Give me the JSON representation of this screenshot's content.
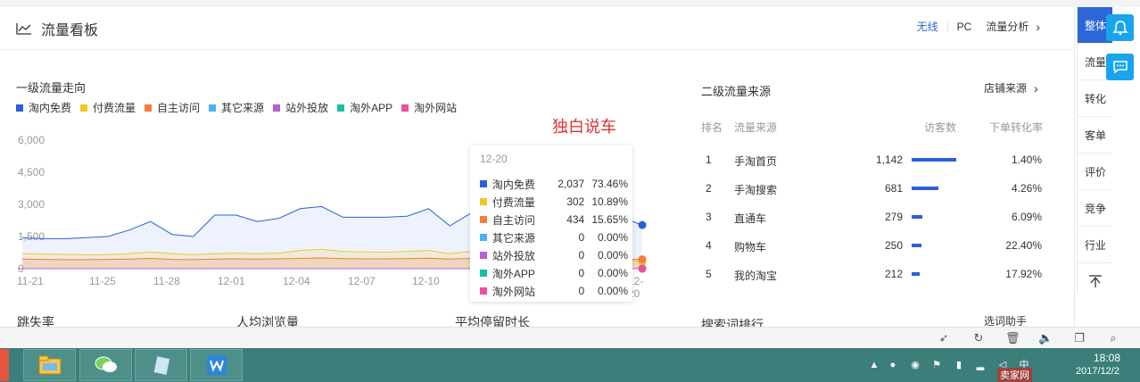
{
  "header": {
    "title": "流量看板",
    "tabs": [
      "无线",
      "PC"
    ],
    "analysis_link": "流量分析"
  },
  "primary": {
    "title": "一级流量走向",
    "legend": [
      {
        "name": "淘内免费",
        "color": "#2b5fd9"
      },
      {
        "name": "付费流量",
        "color": "#f2c526"
      },
      {
        "name": "自主访问",
        "color": "#f57c3a"
      },
      {
        "name": "其它来源",
        "color": "#49b1f5"
      },
      {
        "name": "站外投放",
        "color": "#b45fd6"
      },
      {
        "name": "淘外APP",
        "color": "#13c2a3"
      },
      {
        "name": "淘外网站",
        "color": "#ee4e9a"
      }
    ],
    "watermark": "独白说车"
  },
  "chart_data": {
    "type": "area",
    "x": [
      "11-21",
      "11-22",
      "11-23",
      "11-24",
      "11-25",
      "11-26",
      "11-27",
      "11-28",
      "11-29",
      "11-30",
      "12-01",
      "12-02",
      "12-03",
      "12-04",
      "12-05",
      "12-06",
      "12-07",
      "12-08",
      "12-09",
      "12-10",
      "12-11",
      "12-12",
      "12-13",
      "12-14",
      "12-15",
      "12-16",
      "12-17",
      "12-18",
      "12-19",
      "12-20"
    ],
    "x_tick_labels": [
      "11-21",
      "11-25",
      "11-28",
      "12-01",
      "12-04",
      "12-07",
      "12-10",
      "12-20"
    ],
    "y_tick_labels": [
      "6,000",
      "4,500",
      "3,000",
      "1,500",
      "0"
    ],
    "ylim": [
      0,
      6000
    ],
    "series": [
      {
        "name": "淘内免费",
        "color": "#2b5fd9",
        "values": [
          1450,
          1400,
          1400,
          1450,
          1500,
          1800,
          2200,
          1600,
          1500,
          2500,
          2500,
          2200,
          2350,
          2800,
          2900,
          2400,
          2400,
          2400,
          2450,
          2800,
          2000,
          2600,
          2800,
          3200,
          4300,
          3900,
          3400,
          2600,
          2400,
          2037
        ]
      },
      {
        "name": "付费流量",
        "color": "#f2c526",
        "values": [
          700,
          680,
          660,
          650,
          650,
          700,
          780,
          700,
          650,
          700,
          720,
          700,
          720,
          850,
          900,
          800,
          780,
          770,
          800,
          850,
          700,
          800,
          900,
          1000,
          1600,
          1400,
          1200,
          800,
          500,
          302
        ]
      },
      {
        "name": "自主访问",
        "color": "#f57c3a",
        "values": [
          450,
          430,
          420,
          420,
          430,
          450,
          480,
          430,
          420,
          450,
          460,
          450,
          460,
          480,
          500,
          470,
          460,
          460,
          470,
          490,
          450,
          480,
          500,
          520,
          650,
          600,
          550,
          480,
          450,
          434
        ]
      },
      {
        "name": "其它来源",
        "color": "#49b1f5",
        "values": [
          0,
          0,
          0,
          0,
          0,
          0,
          0,
          0,
          0,
          0,
          0,
          0,
          0,
          0,
          0,
          0,
          0,
          0,
          0,
          0,
          0,
          0,
          0,
          0,
          0,
          0,
          0,
          0,
          0,
          0
        ]
      },
      {
        "name": "站外投放",
        "color": "#b45fd6",
        "values": [
          0,
          0,
          0,
          0,
          0,
          0,
          0,
          0,
          0,
          0,
          0,
          0,
          0,
          0,
          0,
          0,
          0,
          0,
          0,
          0,
          0,
          0,
          0,
          0,
          0,
          0,
          0,
          0,
          0,
          0
        ]
      },
      {
        "name": "淘外APP",
        "color": "#13c2a3",
        "values": [
          0,
          0,
          0,
          0,
          0,
          0,
          0,
          0,
          0,
          0,
          0,
          0,
          0,
          0,
          0,
          0,
          0,
          0,
          0,
          0,
          0,
          0,
          0,
          0,
          0,
          0,
          0,
          0,
          0,
          0
        ]
      },
      {
        "name": "淘外网站",
        "color": "#ee4e9a",
        "values": [
          0,
          0,
          0,
          0,
          0,
          0,
          0,
          0,
          0,
          0,
          0,
          0,
          0,
          0,
          0,
          0,
          0,
          0,
          0,
          0,
          0,
          0,
          0,
          0,
          0,
          0,
          0,
          0,
          0,
          0
        ]
      }
    ],
    "grid": false,
    "legend_position": "top-left"
  },
  "tooltip": {
    "date": "12-20",
    "rows": [
      {
        "name": "淘内免费",
        "value": "2,037",
        "pct": "73.46%",
        "color": "#2b5fd9"
      },
      {
        "name": "付费流量",
        "value": "302",
        "pct": "10.89%",
        "color": "#f2c526"
      },
      {
        "name": "自主访问",
        "value": "434",
        "pct": "15.65%",
        "color": "#f57c3a"
      },
      {
        "name": "其它来源",
        "value": "0",
        "pct": "0.00%",
        "color": "#49b1f5"
      },
      {
        "name": "站外投放",
        "value": "0",
        "pct": "0.00%",
        "color": "#b45fd6"
      },
      {
        "name": "淘外APP",
        "value": "0",
        "pct": "0.00%",
        "color": "#13c2a3"
      },
      {
        "name": "淘外网站",
        "value": "0",
        "pct": "0.00%",
        "color": "#ee4e9a"
      }
    ]
  },
  "secondary": {
    "title": "二级流量来源",
    "shop_link": "店铺来源",
    "headers": [
      "排名",
      "流量来源",
      "访客数",
      "下单转化率"
    ],
    "rows": [
      {
        "rank": "1",
        "source": "手淘首页",
        "visitors": "1,142",
        "visitors_num": 1142,
        "rate": "1.40%"
      },
      {
        "rank": "2",
        "source": "手淘搜索",
        "visitors": "681",
        "visitors_num": 681,
        "rate": "4.26%"
      },
      {
        "rank": "3",
        "source": "直通车",
        "visitors": "279",
        "visitors_num": 279,
        "rate": "6.09%"
      },
      {
        "rank": "4",
        "source": "购物车",
        "visitors": "250",
        "visitors_num": 250,
        "rate": "22.40%"
      },
      {
        "rank": "5",
        "source": "我的淘宝",
        "visitors": "212",
        "visitors_num": 212,
        "rate": "17.92%"
      }
    ]
  },
  "bottom": {
    "bounce": "跳失率",
    "pv": "人均浏览量",
    "stay": "平均停留时长",
    "keywords": "搜索词排行",
    "helper": "选词助手"
  },
  "sidenav": [
    "整体",
    "流量",
    "转化",
    "客单",
    "评价",
    "竞争",
    "行业"
  ],
  "taskbar": {
    "time": "18:08",
    "date": "2017/12/2",
    "site": "卖家网"
  }
}
